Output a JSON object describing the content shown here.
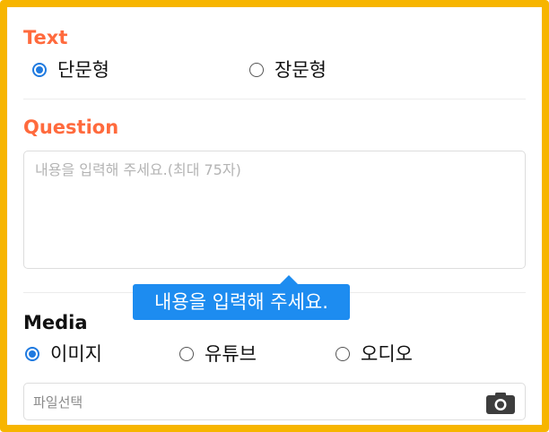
{
  "text_section": {
    "title": "Text",
    "options": [
      {
        "label": "단문형",
        "checked": true
      },
      {
        "label": "장문형",
        "checked": false
      }
    ]
  },
  "question_section": {
    "title": "Question",
    "placeholder": "내용을 입력해 주세요.(최대 75자)"
  },
  "tooltip": {
    "message": "내용을 입력해 주세요."
  },
  "media_section": {
    "title": "Media",
    "options": [
      {
        "label": "이미지",
        "checked": true
      },
      {
        "label": "유튜브",
        "checked": false
      },
      {
        "label": "오디오",
        "checked": false
      }
    ],
    "file_placeholder": "파일선택",
    "file_icon": "camera-icon"
  },
  "colors": {
    "frame_border": "#f7b500",
    "accent_orange": "#ff6a3d",
    "radio_blue": "#1f7ae0",
    "tooltip_blue": "#1d8cf0"
  }
}
